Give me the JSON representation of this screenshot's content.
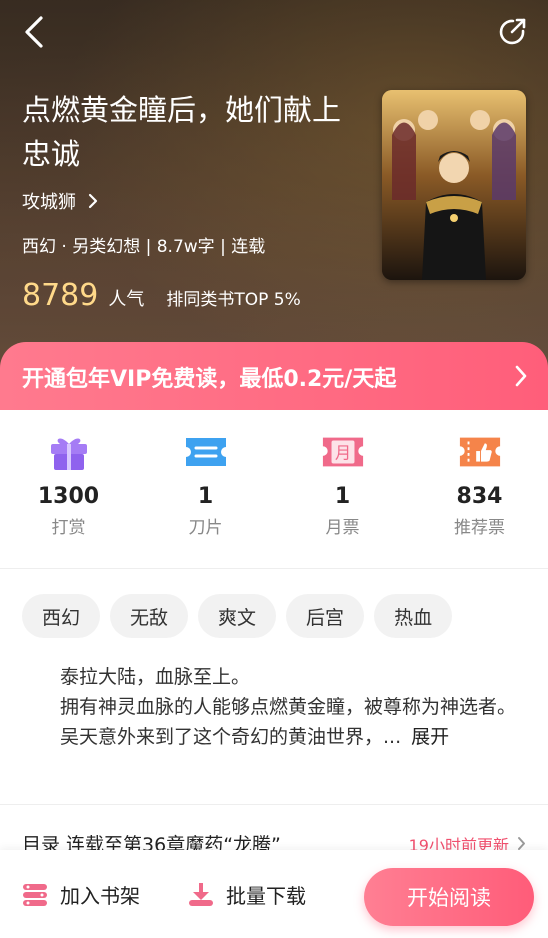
{
  "header": {
    "title": "点燃黄金瞳后，她们献上忠诚",
    "author": "攻城狮",
    "meta": "西幻 · 另类幻想 | 8.7w字 | 连载",
    "popularity": "8789",
    "popularity_label": "人气",
    "rank": "排同类书TOP 5%"
  },
  "vip": {
    "text": "开通包年VIP免费读，最低0.2元/天起"
  },
  "stats": [
    {
      "value": "1300",
      "label": "打赏",
      "icon": "gift-icon"
    },
    {
      "value": "1",
      "label": "刀片",
      "icon": "ticket-icon"
    },
    {
      "value": "1",
      "label": "月票",
      "icon": "month-ticket-icon"
    },
    {
      "value": "834",
      "label": "推荐票",
      "icon": "thumbs-up-ticket-icon"
    }
  ],
  "month_icon_char": "月",
  "tags": [
    "西幻",
    "无敌",
    "爽文",
    "后宫",
    "热血"
  ],
  "description": {
    "line1": "泰拉大陆，血脉至上。",
    "line2": "拥有神灵血脉的人能够点燃黄金瞳，被尊称为神选者。",
    "line3": "吴天意外来到了这个奇幻的黄油世界，...",
    "expand": "展开"
  },
  "toc": {
    "label": "目录 连载至第36章魔药“龙腾”",
    "updated": "19小时前更新"
  },
  "bottom": {
    "shelf": "加入书架",
    "download": "批量下载",
    "read": "开始阅读"
  },
  "colors": {
    "accent": "#ff5e7a",
    "popularity": "#ffd98a",
    "update": "#f0506e",
    "gift": "#9b6cf0",
    "ticket": "#3ea2f0",
    "month": "#f06a8a",
    "recommend": "#f5844a"
  }
}
